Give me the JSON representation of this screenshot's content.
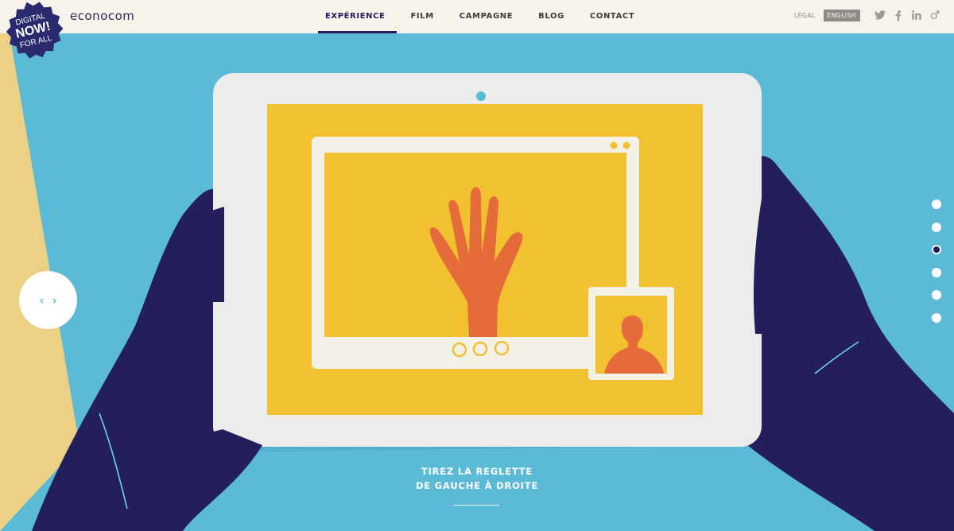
{
  "badge": {
    "line1": "DIGITAL",
    "line2": "NOW!",
    "line3": "FOR ALL"
  },
  "brand": {
    "name": "econocom"
  },
  "nav": [
    {
      "label": "EXPÉRIENCE",
      "active": true
    },
    {
      "label": "FILM",
      "active": false
    },
    {
      "label": "CAMPAGNE",
      "active": false
    },
    {
      "label": "BLOG",
      "active": false
    },
    {
      "label": "CONTACT",
      "active": false
    }
  ],
  "tools": {
    "legal": "LÉGAL",
    "english": "ENGLISH"
  },
  "social_icons": [
    "twitter-icon",
    "facebook-icon",
    "linkedin-icon",
    "gender-symbol-icon"
  ],
  "cta": {
    "line1": "TIREZ LA REGLETTE",
    "line2": "DE GAUCHE À DROITE"
  },
  "pager": {
    "count": 6,
    "active_index": 2
  },
  "colors": {
    "sky": "#5bbad6",
    "navy": "#231f5c",
    "yellow": "#f1c12f",
    "orange": "#e66b3a",
    "cream": "#f7f2ea"
  }
}
